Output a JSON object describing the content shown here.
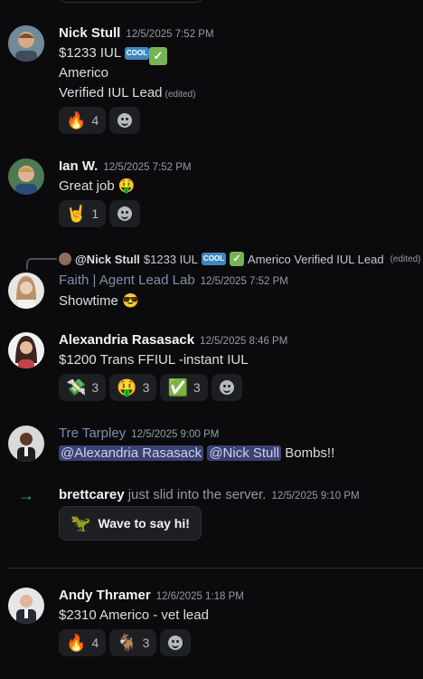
{
  "messages": [
    {
      "author": "Nick Stull",
      "time": "12/5/2025 7:52 PM",
      "lines": [
        "$1233 IUL",
        "Americo",
        "Verified IUL Lead"
      ],
      "edited": "(edited)",
      "badge_text": "COOL",
      "reactions": [
        {
          "emoji": "🔥",
          "count": "4"
        }
      ]
    },
    {
      "author": "Ian W.",
      "time": "12/5/2025 7:52 PM",
      "text": "Great job",
      "reactions": [
        {
          "emoji": "🤘",
          "count": "1"
        }
      ]
    },
    {
      "author": "Faith | Agent Lead Lab",
      "time": "12/5/2025 7:52 PM",
      "reply": {
        "mention": "@Nick Stull",
        "text1": "$1233 IUL",
        "text2": "Americo Verified IUL Lead",
        "edited": "(edited)"
      },
      "text": "Showtime"
    },
    {
      "author": "Alexandria Rasasack",
      "time": "12/5/2025 8:46 PM",
      "text": "$1200 Trans FFIUL -instant IUL",
      "reactions": [
        {
          "emoji": "💸",
          "count": "3"
        },
        {
          "emoji": "🤑",
          "count": "3"
        },
        {
          "emoji": "✅",
          "count": "3"
        }
      ]
    },
    {
      "author": "Tre Tarpley",
      "time": "12/5/2025 9:00 PM",
      "mention1": "@Alexandria Rasasack",
      "mention2": "@Nick Stull",
      "text": "Bombs!!"
    },
    {
      "join_user": "brettcarey",
      "join_text": "just slid into the server.",
      "time": "12/5/2025 9:10 PM",
      "wave_label": "Wave to say hi!"
    },
    {
      "author": "Andy Thramer",
      "time": "12/6/2025 1:18 PM",
      "text": "$2310 Americo - vet lead",
      "reactions": [
        {
          "emoji": "🔥",
          "count": "4"
        },
        {
          "emoji": "🐐",
          "count": "3"
        }
      ]
    }
  ],
  "colors": {
    "background": "#0b0b0d",
    "mention_bg": "#3c4270",
    "join_arrow": "#3ba55c"
  }
}
